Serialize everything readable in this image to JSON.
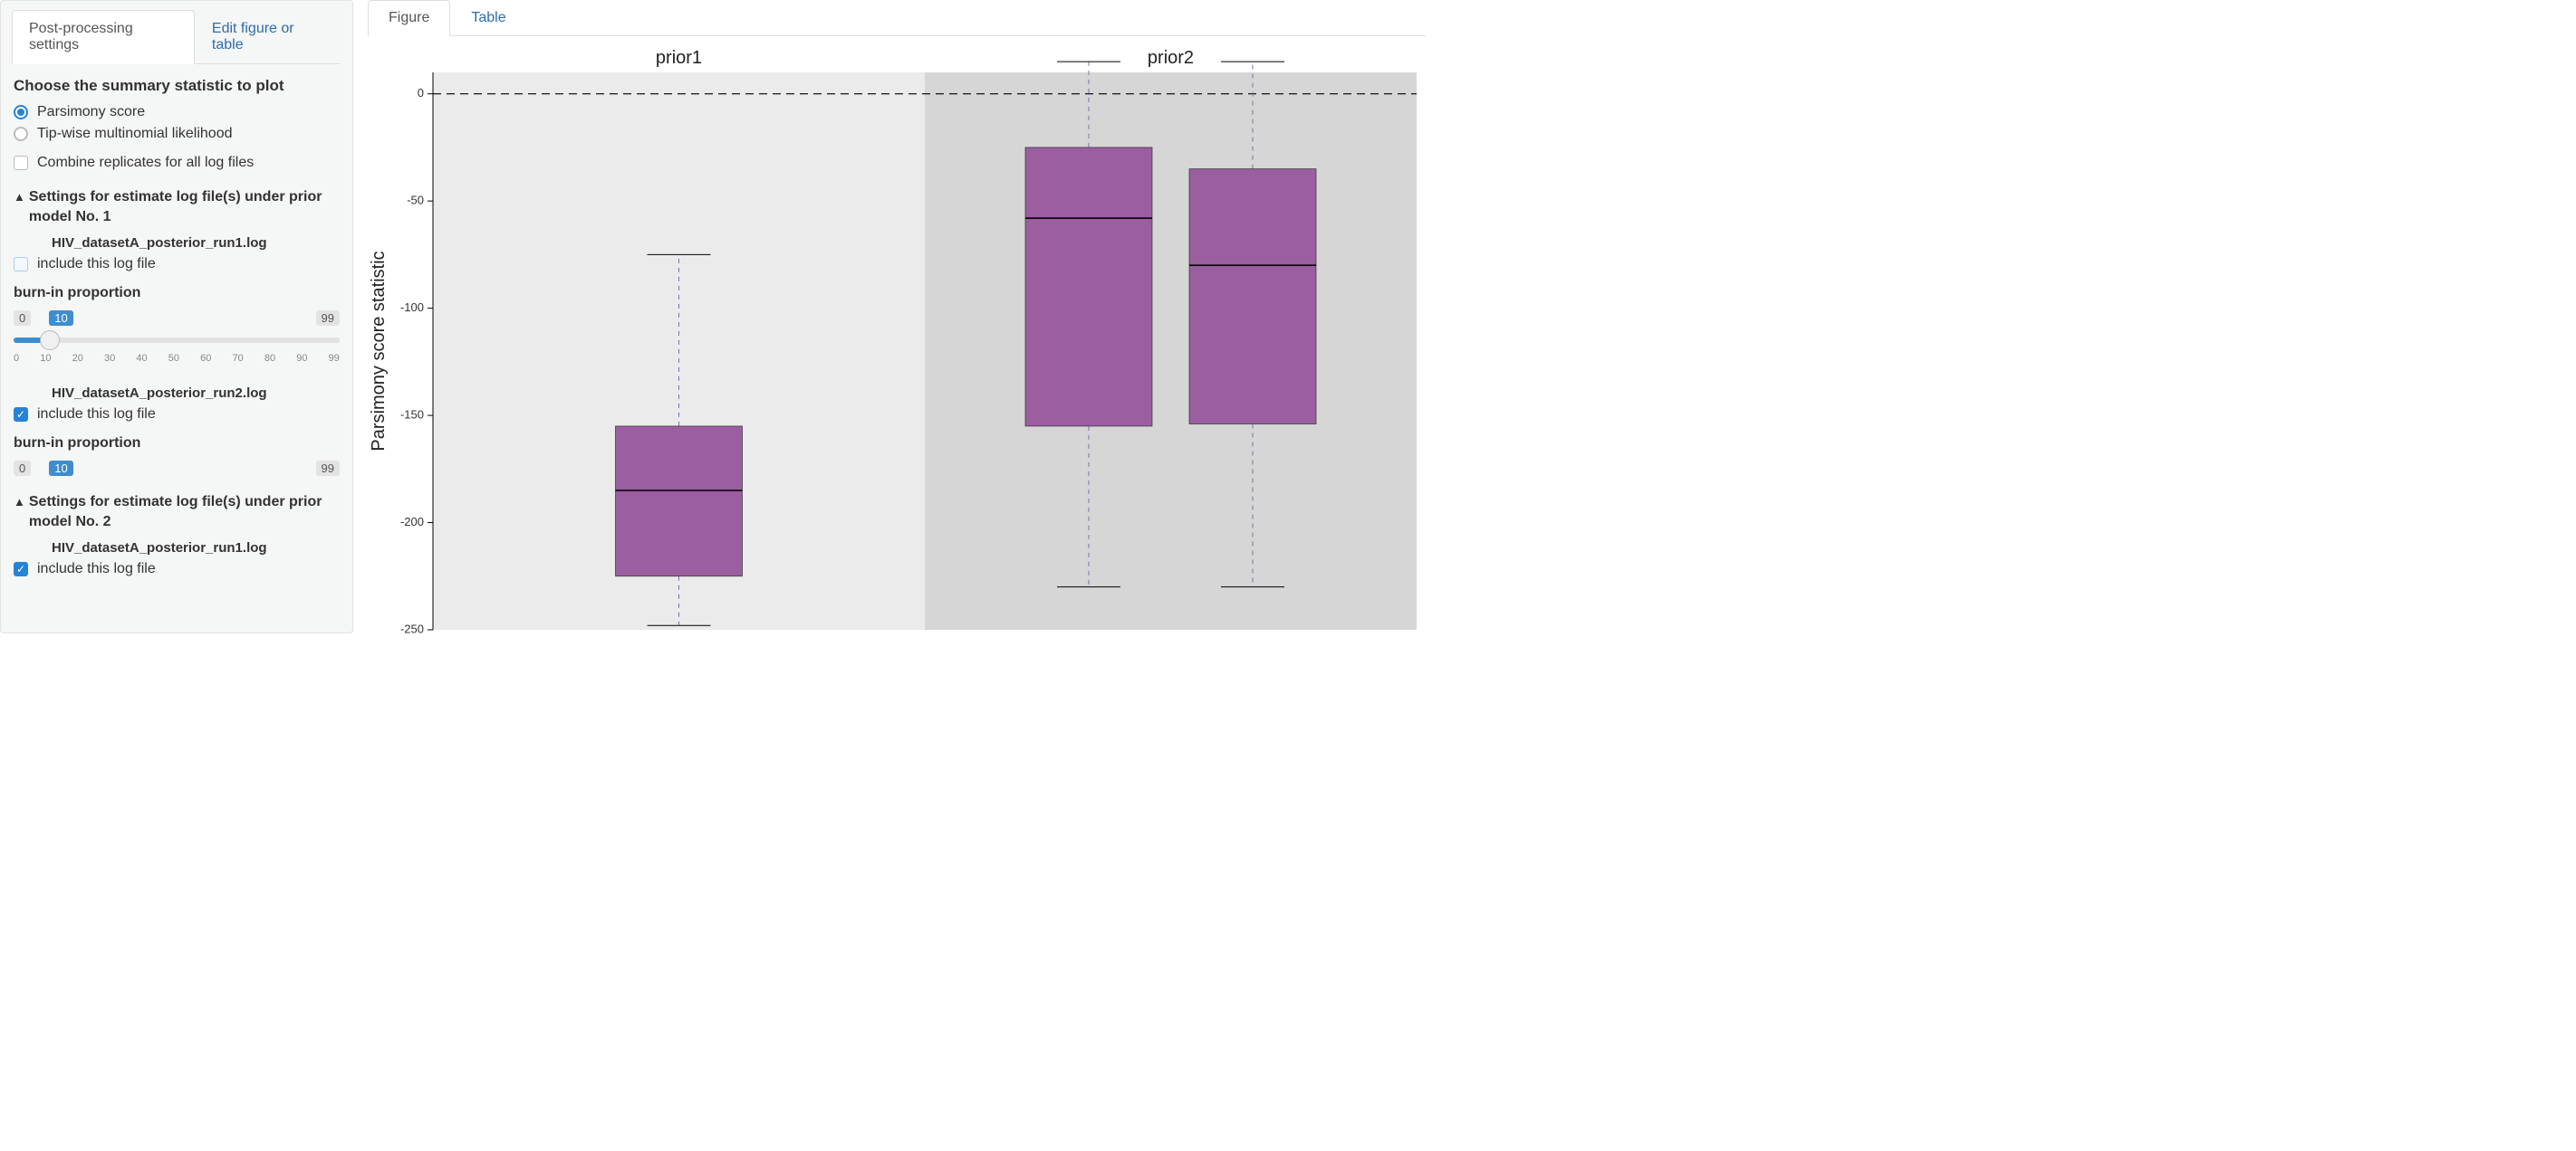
{
  "sidebar": {
    "tabs": {
      "settings": "Post-processing settings",
      "edit": "Edit figure or table"
    },
    "summary_heading": "Choose the summary statistic to plot",
    "radio_parsimony": "Parsimony score",
    "radio_tipwise": "Tip-wise multinomial likelihood",
    "combine_reps": "Combine replicates for all log files",
    "group1_title": "Settings for estimate log file(s) under prior model No. 1",
    "group2_title": "Settings for estimate log file(s) under prior model No. 2",
    "file1": "HIV_datasetA_posterior_run1.log",
    "file2": "HIV_datasetA_posterior_run2.log",
    "file3": "HIV_datasetA_posterior_run1.log",
    "include_label": "include this log file",
    "burnin_label": "burn-in proportion",
    "slider_min": "0",
    "slider_max": "99",
    "slider_val": "10",
    "slider_ticks": [
      "0",
      "10",
      "20",
      "30",
      "40",
      "50",
      "60",
      "70",
      "80",
      "90",
      "99"
    ]
  },
  "main_tabs": {
    "figure": "Figure",
    "table": "Table"
  },
  "chart_data": {
    "type": "boxplot",
    "ylabel": "Parsimony score statistic",
    "ylim": [
      -250,
      10
    ],
    "yticks": [
      0,
      -50,
      -100,
      -150,
      -200,
      -250
    ],
    "facets": [
      "prior1",
      "prior2"
    ],
    "reference_line": 0,
    "fill": "#9a5ea1",
    "boxes": [
      {
        "facet": "prior1",
        "lower_whisker": -248,
        "q1": -225,
        "median": -185,
        "q3": -155,
        "upper_whisker": -75
      },
      {
        "facet": "prior2",
        "lower_whisker": -230,
        "q1": -155,
        "median": -58,
        "q3": -25,
        "upper_whisker": 15
      },
      {
        "facet": "prior2",
        "lower_whisker": -230,
        "q1": -154,
        "median": -80,
        "q3": -35,
        "upper_whisker": 15
      }
    ]
  }
}
